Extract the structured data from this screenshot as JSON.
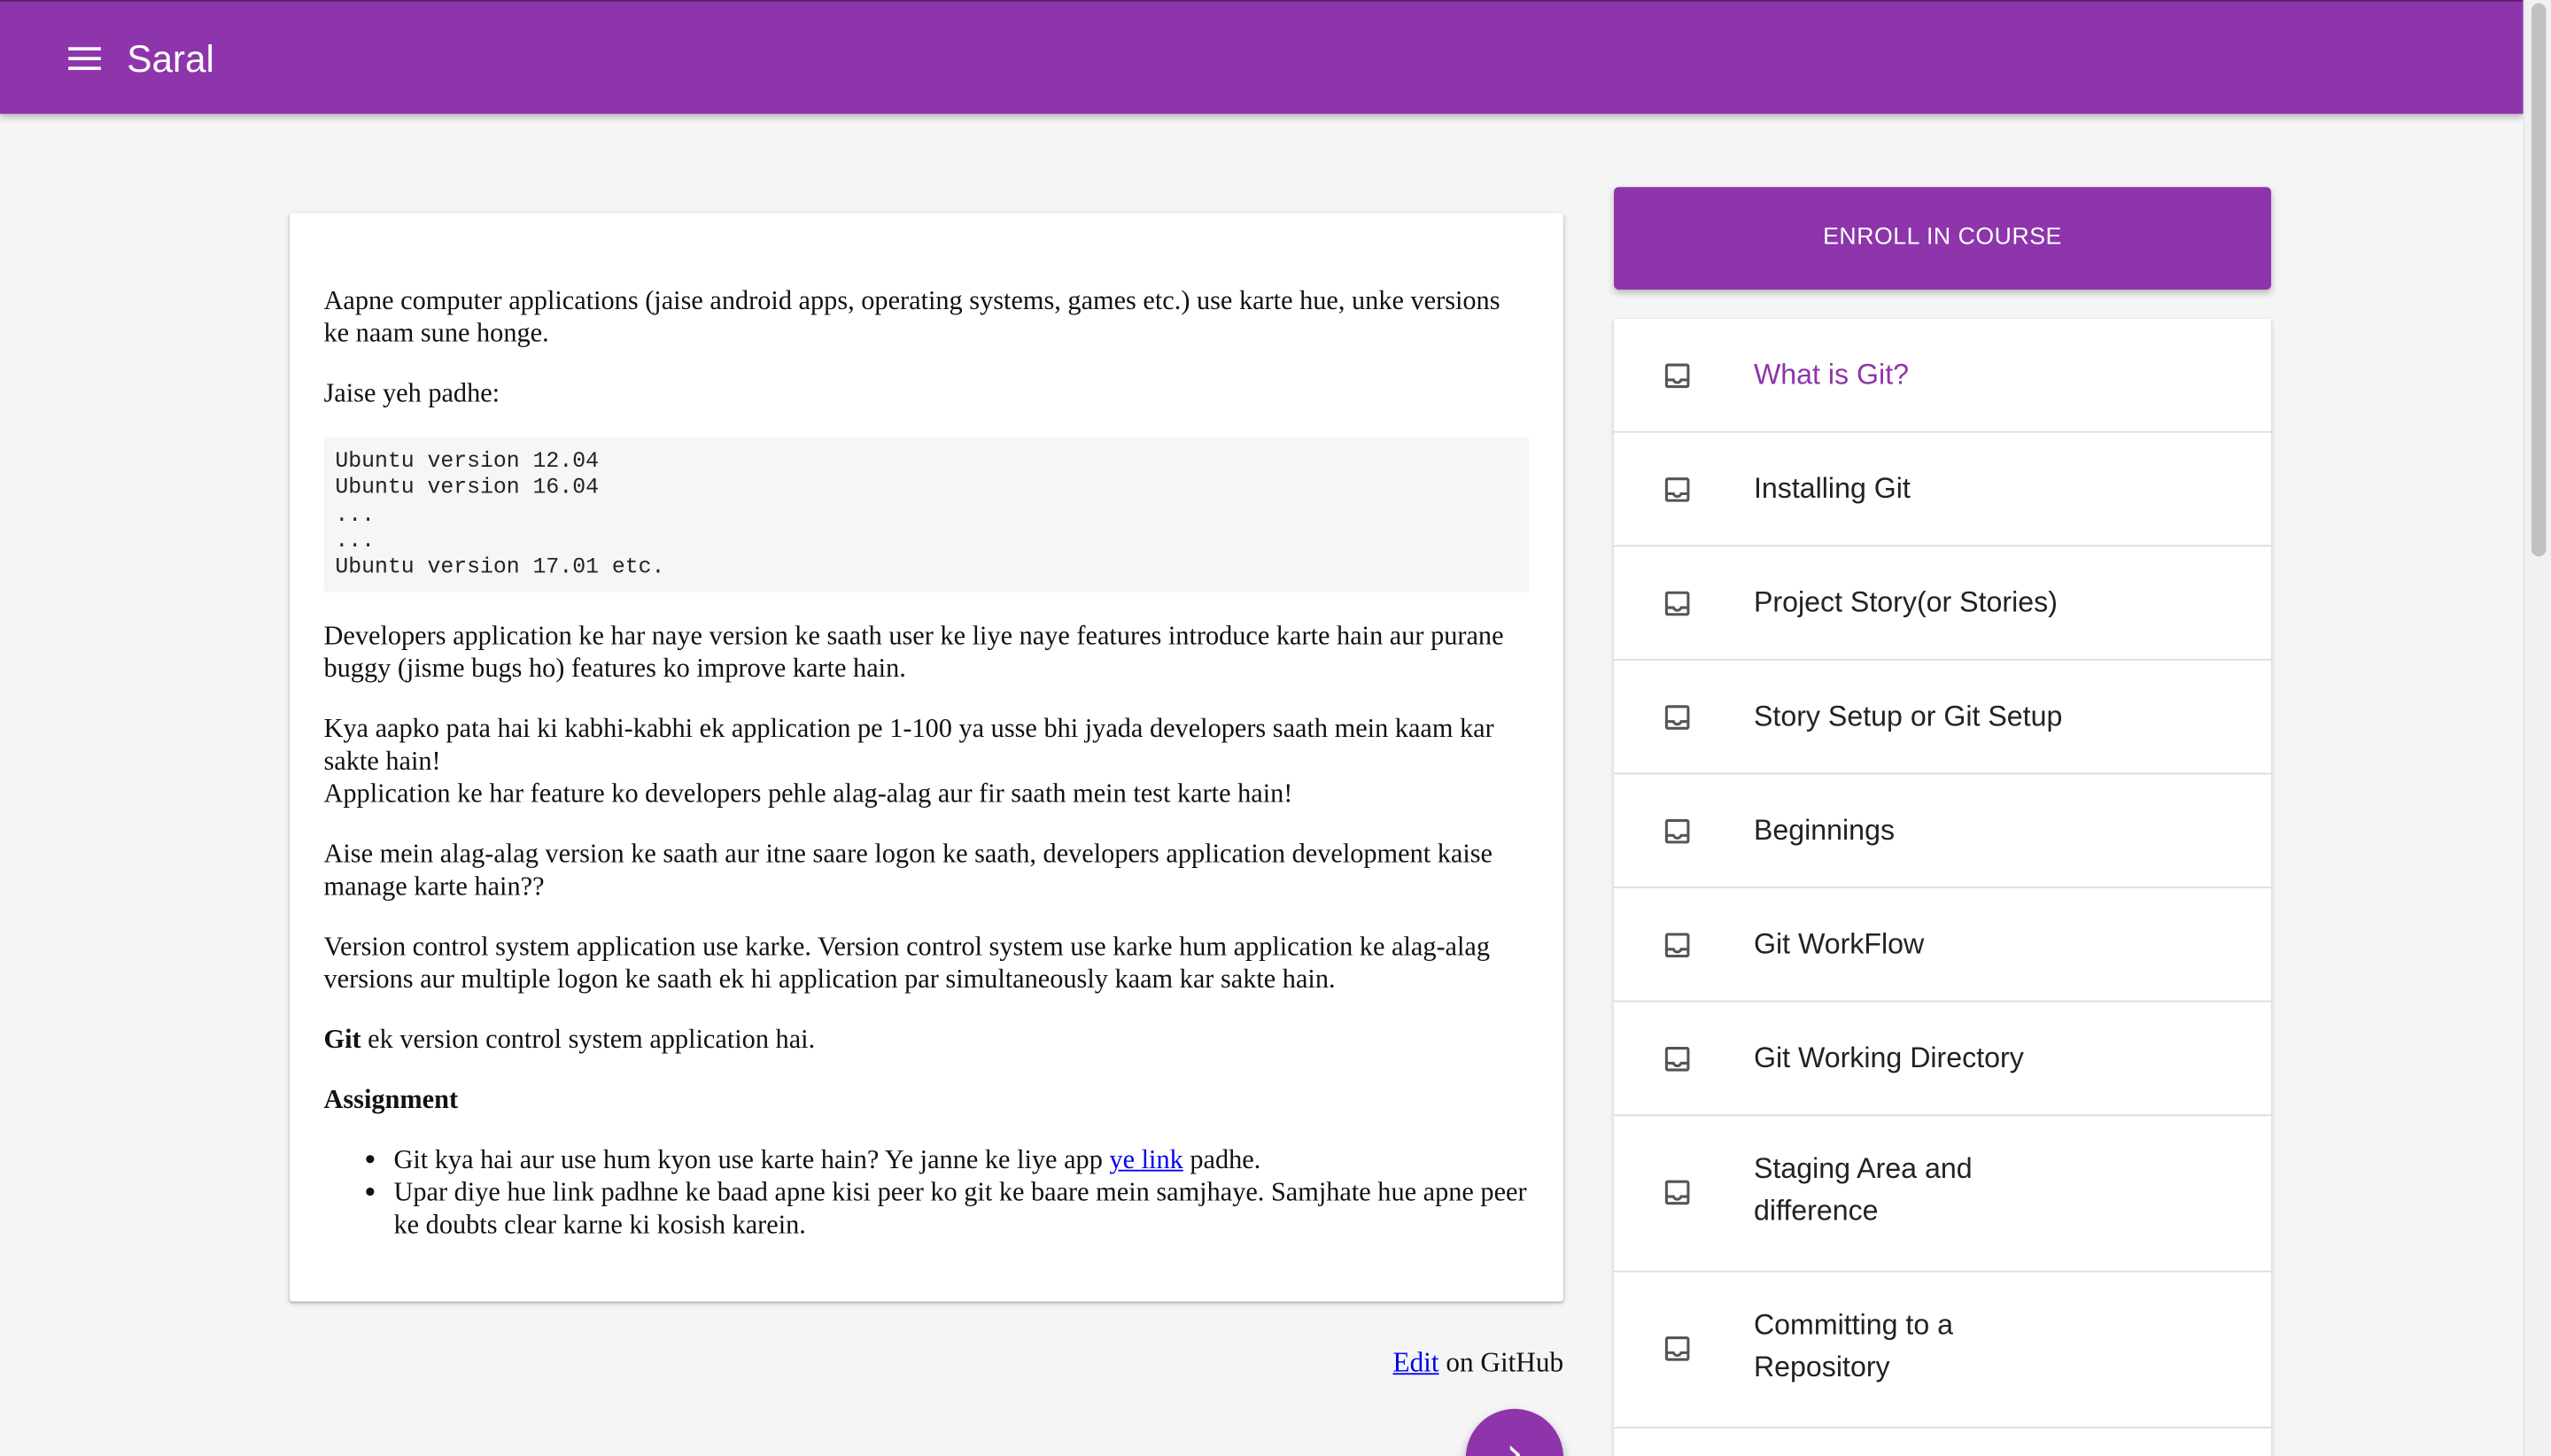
{
  "app": {
    "title": "Saral"
  },
  "theme": {
    "primary": "#8e35ab",
    "link": "#0000ee"
  },
  "content": {
    "intro": "Aapne computer applications (jaise android apps, operating systems, games etc.) use karte hue, unke versions ke naam sune honge.",
    "example_lead": "Jaise yeh padhe:",
    "code_block": "Ubuntu version 12.04\nUbuntu version 16.04\n...\n...\nUbuntu version 17.01 etc.",
    "para_developers": "Developers application ke har naye version ke saath user ke liye naye features introduce karte hain aur purane buggy (jisme bugs ho) features ko improve karte hain.",
    "para_many_devs_1": "Kya aapko pata hai ki kabhi-kabhi ek application pe 1-100 ya usse bhi jyada developers saath mein kaam kar sakte hain!",
    "para_many_devs_2": "Application ke har feature ko developers pehle alag-alag aur fir saath mein test karte hain!",
    "para_question": "Aise mein alag-alag version ke saath aur itne saare logon ke saath, developers application development kaise manage karte hain??",
    "para_vcs": "Version control system application use karke. Version control system use karke hum application ke alag-alag versions aur multiple logon ke saath ek hi application par simultaneously kaam kar sakte hain.",
    "git_bold": "Git",
    "git_rest": " ek version control system application hai.",
    "assignment_heading": "Assignment",
    "assignment_items": {
      "item1_before": "Git kya hai aur use hum kyon use karte hain? Ye janne ke liye app ",
      "item1_link": "ye link",
      "item1_after": " padhe.",
      "item2": "Upar diye hue link padhne ke baad apne kisi peer ko git ke baare mein samjhaye. Samjhate hue apne peer ke doubts clear karne ki kosish karein."
    }
  },
  "footer": {
    "edit_link": "Edit",
    "edit_suffix": " on GitHub"
  },
  "sidebar": {
    "enroll_label": "ENROLL IN COURSE",
    "lessons": [
      {
        "label": "What is Git?",
        "active": true,
        "icon": "inbox-icon"
      },
      {
        "label": "Installing Git",
        "active": false,
        "icon": "inbox-icon"
      },
      {
        "label": "Project Story(or Stories)",
        "active": false,
        "icon": "inbox-icon"
      },
      {
        "label": "Story Setup or Git Setup",
        "active": false,
        "icon": "inbox-icon"
      },
      {
        "label": "Beginnings",
        "active": false,
        "icon": "inbox-icon"
      },
      {
        "label": "Git WorkFlow",
        "active": false,
        "icon": "inbox-icon"
      },
      {
        "label": "Git Working Directory",
        "active": false,
        "icon": "inbox-icon"
      },
      {
        "label": "Staging Area and difference",
        "active": false,
        "icon": "inbox-icon"
      },
      {
        "label": "Committing to a Repository",
        "active": false,
        "icon": "inbox-icon"
      }
    ]
  },
  "fab": {
    "icon": "chevron-right-icon"
  }
}
